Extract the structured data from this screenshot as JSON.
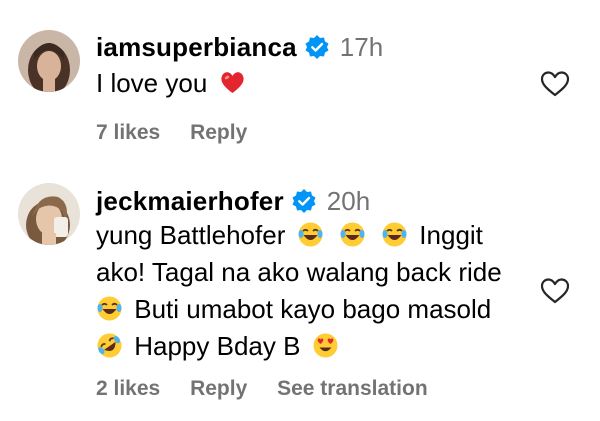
{
  "comments": [
    {
      "username": "iamsuperbianca",
      "time": "17h",
      "text": [
        "I love you"
      ],
      "likes": "7 likes",
      "reply": "Reply"
    },
    {
      "username": "jeckmaierhofer",
      "time": "20h",
      "lines": {
        "l1a": "yung Battlehofer",
        "l1b": "Inggit",
        "l2": "ako! Tagal na ako walang back ride",
        "l3": "Buti umabot kayo bago masold",
        "l4": "Happy Bday B"
      },
      "likes": "2 likes",
      "reply": "Reply",
      "translate": "See translation"
    }
  ],
  "colors": {
    "verified": "#0095f6",
    "secondary_text": "#737373",
    "heart": "#ed1c24"
  },
  "icons": {
    "verified": "verified-badge-icon",
    "like": "heart-outline-icon",
    "emoji_heart": "red-heart-emoji",
    "emoji_laugh": "face-with-tears-of-joy-emoji",
    "emoji_rofl": "rolling-on-floor-laughing-emoji",
    "emoji_heart_eyes": "smiling-face-with-heart-eyes-emoji"
  }
}
